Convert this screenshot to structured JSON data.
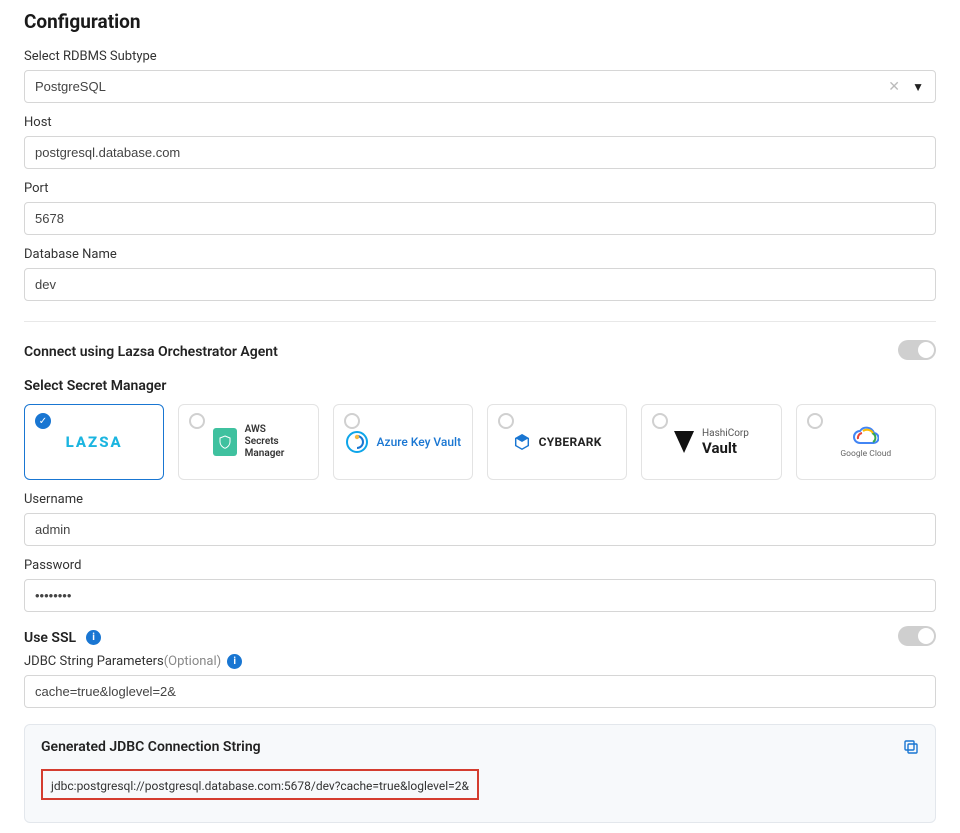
{
  "config": {
    "title": "Configuration",
    "rdbms": {
      "label": "Select RDBMS Subtype",
      "value": "PostgreSQL"
    },
    "host": {
      "label": "Host",
      "value": "postgresql.database.com"
    },
    "port": {
      "label": "Port",
      "value": "5678"
    },
    "dbname": {
      "label": "Database Name",
      "value": "dev"
    },
    "connect_agent": {
      "label": "Connect using Lazsa Orchestrator Agent"
    },
    "secret_manager": {
      "label": "Select Secret Manager"
    },
    "secrets": {
      "lazsa": {
        "name": "LAZSA"
      },
      "aws": {
        "line1": "AWS",
        "line2": "Secrets",
        "line3": "Manager"
      },
      "azure": {
        "name": "Azure Key Vault"
      },
      "cyberark": {
        "name": "CYBERARK"
      },
      "vault": {
        "brand": "HashiCorp",
        "name": "Vault"
      },
      "gcloud": {
        "name": "Google Cloud"
      }
    },
    "username": {
      "label": "Username",
      "value": "admin"
    },
    "password": {
      "label": "Password",
      "value": "••••••••"
    },
    "use_ssl": {
      "label": "Use SSL"
    },
    "jdbc_params": {
      "label": "JDBC String Parameters ",
      "optional": "(Optional)",
      "value": "cache=true&loglevel=2&"
    },
    "gen_conn": {
      "title": "Generated JDBC Connection String",
      "value": "jdbc:postgresql://postgresql.database.com:5678/dev?cache=true&loglevel=2&"
    }
  }
}
